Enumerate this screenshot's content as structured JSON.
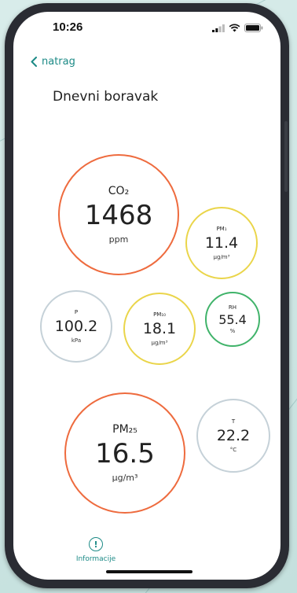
{
  "status": {
    "time": "10:26"
  },
  "nav": {
    "back_label": "natrag"
  },
  "room": {
    "title": "Dnevni boravak"
  },
  "colors": {
    "accent": "#1c8a86",
    "poor": "#ee6b3e",
    "moderate": "#ead54a",
    "good": "#40b36a",
    "neutral": "#c5d1d8"
  },
  "metrics": {
    "co2": {
      "label": "CO₂",
      "value": "1468",
      "unit": "ppm",
      "status": "poor"
    },
    "pm1": {
      "label": "PM₁",
      "value": "11.4",
      "unit": "µg/m³",
      "status": "moderate"
    },
    "pressure": {
      "label": "P",
      "value": "100.2",
      "unit": "kPa",
      "status": "neutral"
    },
    "pm10": {
      "label": "PM₁₀",
      "value": "18.1",
      "unit": "µg/m³",
      "status": "moderate"
    },
    "rh": {
      "label": "RH",
      "value": "55.4",
      "unit": "%",
      "status": "good"
    },
    "pm25": {
      "label": "PM₂₅",
      "value": "16.5",
      "unit": "µg/m³",
      "status": "poor"
    },
    "temp": {
      "label": "T",
      "value": "22.2",
      "unit": "°C",
      "status": "neutral"
    }
  },
  "footer": {
    "info_label": "Informacije",
    "info_icon": "info-icon"
  }
}
